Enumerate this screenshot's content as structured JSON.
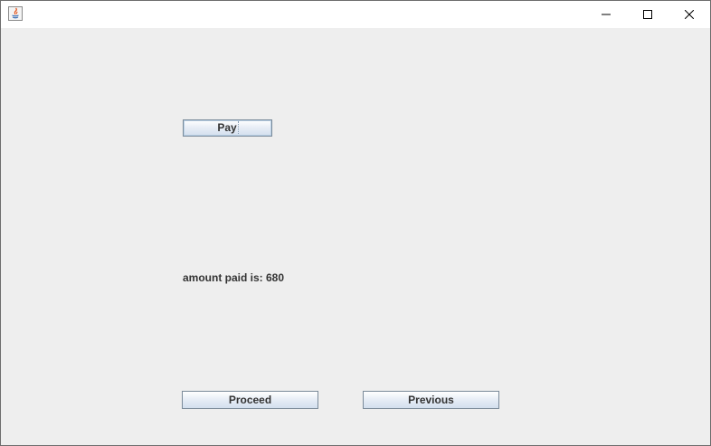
{
  "window": {
    "app_icon": "java-icon",
    "controls": {
      "minimize_icon": "minimize-icon",
      "maximize_icon": "maximize-icon",
      "close_icon": "close-icon"
    }
  },
  "main": {
    "pay_button_label": "Pay",
    "amount_text": "amount paid is: 680",
    "proceed_button_label": "Proceed",
    "previous_button_label": "Previous"
  },
  "colors": {
    "background": "#eeeeee",
    "button_border": "#7a8a99",
    "text": "#333333"
  }
}
